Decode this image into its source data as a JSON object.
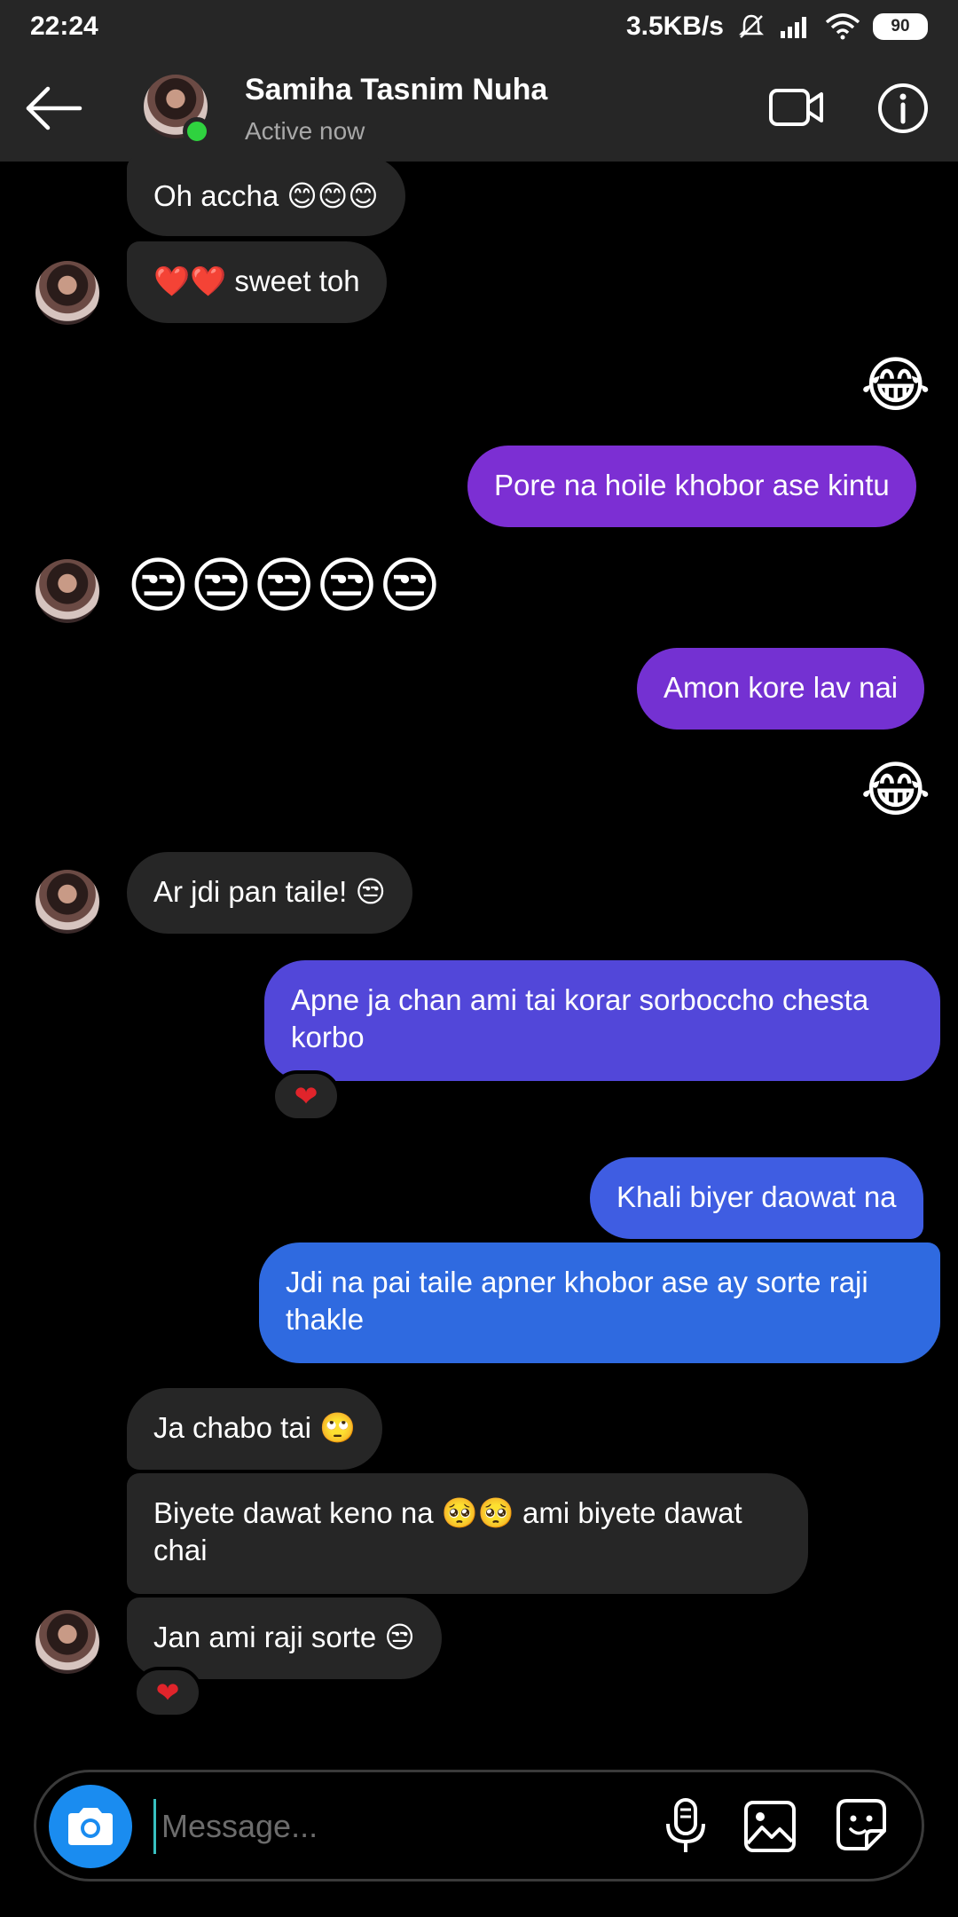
{
  "status_bar": {
    "time": "22:24",
    "net_speed": "3.5KB/s",
    "battery": "90",
    "icons": [
      "mute-icon",
      "signal-icon",
      "wifi-icon",
      "battery-icon"
    ]
  },
  "header": {
    "name": "Samiha Tasnim Nuha",
    "status": "Active now",
    "icons": [
      "back-arrow-icon",
      "video-call-icon",
      "info-icon"
    ]
  },
  "messages": [
    {
      "from": "them",
      "text": "Oh accha 😊😊😊"
    },
    {
      "from": "them",
      "text": "❤️❤️ sweet toh"
    },
    {
      "from": "me",
      "text": "😂"
    },
    {
      "from": "me",
      "text": "Pore na hoile khobor ase kintu"
    },
    {
      "from": "them",
      "text": "😒😒😒😒😒"
    },
    {
      "from": "me",
      "text": "Amon kore lav nai"
    },
    {
      "from": "me",
      "text": "😂"
    },
    {
      "from": "them",
      "text": "Ar jdi pan taile! 😒"
    },
    {
      "from": "me",
      "text": "Apne ja chan ami tai korar sorboccho chesta korbo",
      "reaction": "❤"
    },
    {
      "from": "me",
      "text": "Khali biyer daowat na"
    },
    {
      "from": "me",
      "text": "Jdi na pai taile apner khobor ase ay sorte raji thakle"
    },
    {
      "from": "them",
      "text": "Ja chabo tai 🙄"
    },
    {
      "from": "them",
      "text": "Biyete dawat keno na 🥺🥺 ami biyete dawat chai"
    },
    {
      "from": "them",
      "text": "Jan ami raji sorte 😒",
      "reaction": "❤"
    }
  ],
  "composer": {
    "placeholder": "Message...",
    "icons": [
      "camera-icon",
      "microphone-icon",
      "gallery-icon",
      "sticker-icon"
    ]
  },
  "colors": {
    "header_bg": "#262626",
    "incoming_bubble": "#262626",
    "outgoing_top": "#7b2fd1",
    "outgoing_bottom": "#2f6fe0",
    "online": "#2fd23f",
    "camera_button": "#1a8cf0"
  }
}
